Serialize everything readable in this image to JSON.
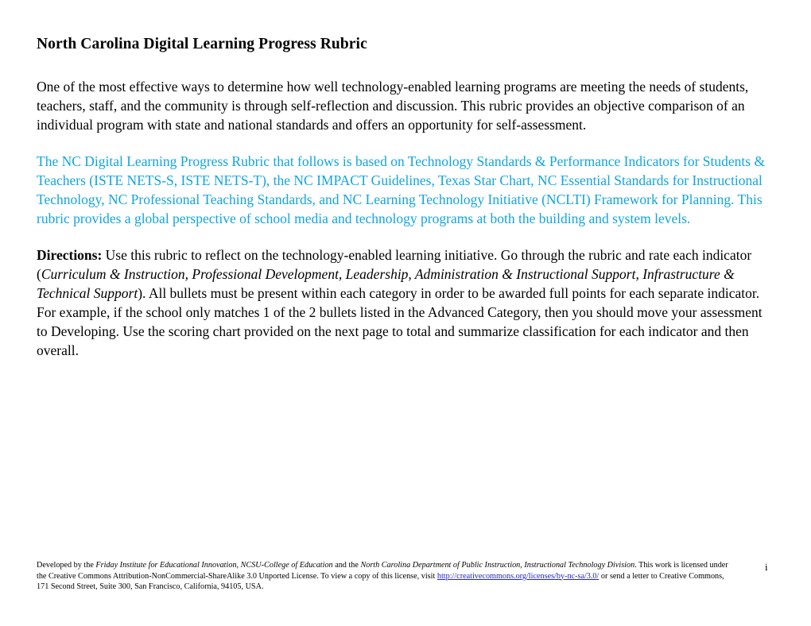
{
  "document": {
    "title": "North Carolina Digital Learning Progress Rubric",
    "page_number": "i"
  },
  "intro_paragraph": {
    "text": "One of the most effective ways to determine how well technology-enabled learning programs are meeting the needs of students, teachers, staff, and the community is through self-reflection and discussion. This rubric provides an objective comparison of an individual program with state and national standards and offers an opportunity for self-assessment."
  },
  "basis_paragraph": {
    "color": "#12A5DE",
    "text": "The NC Digital Learning Progress Rubric that follows is based on Technology Standards & Performance Indicators for Students & Teachers (ISTE NETS-S, ISTE NETS-T), the NC IMPACT Guidelines, Texas Star Chart, NC Essential Standards for Instructional Technology, NC Professional Teaching Standards, and NC Learning Technology Initiative (NCLTI) Framework for Planning. This rubric provides a global perspective of school media and technology programs at both the building and system levels."
  },
  "directions_paragraph": {
    "label": "Directions:",
    "part1": " Use this rubric to reflect on the technology-enabled learning initiative.  Go through the rubric and rate each indicator (",
    "indicators_italic": "Curriculum & Instruction, Professional Development, Leadership, Administration & Instructional Support, Infrastructure & Technical Support",
    "part2": ").  All bullets must be present within each category in order to be awarded full points for each separate indicator. For example, if the school only matches 1 of the 2 bullets listed in the Advanced Category, then you should move your assessment to Developing.  Use the scoring chart provided on the next page to total and summarize classification for each indicator and then overall."
  },
  "footer": {
    "seg1": "Developed by the ",
    "org1_italic": "Friday Institute for Educational Innovation, NCSU-College of Education",
    "seg2": " and the ",
    "org2_italic": "North Carolina Department of Public Instruction, Instructional Technology Division",
    "seg3": ".  This work is licensed under the Creative Commons Attribution-NonCommercial-ShareAlike 3.0 Unported License. To view a copy of this license, visit ",
    "link_text": "http://creativecommons.org/licenses/by-nc-sa/3.0/",
    "link_color": "#2222CC",
    "seg4": " or send a letter to Creative Commons, 171 Second Street, Suite 300, San Francisco, California, 94105, USA."
  }
}
